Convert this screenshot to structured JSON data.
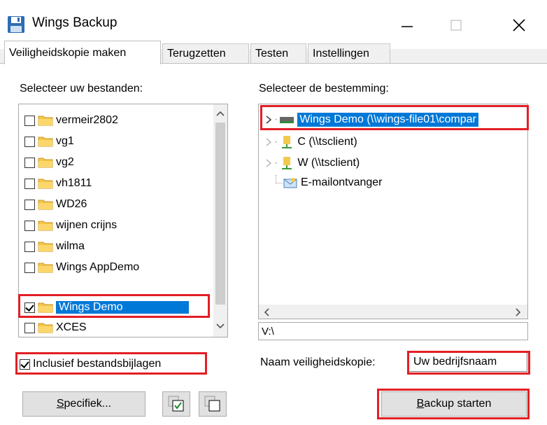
{
  "window": {
    "title": "Wings Backup",
    "controls": {
      "minimize": "—",
      "maximize": "☐",
      "close": "✕"
    }
  },
  "tabs": [
    {
      "label": "Veiligheidskopie maken",
      "active": true
    },
    {
      "label": "Terugzetten",
      "active": false
    },
    {
      "label": "Testen",
      "active": false
    },
    {
      "label": "Instellingen",
      "active": false
    }
  ],
  "source": {
    "label": "Selecteer uw bestanden:",
    "items": [
      {
        "label": "vermeir2802",
        "checked": false,
        "selected": false
      },
      {
        "label": "vg1",
        "checked": false,
        "selected": false
      },
      {
        "label": "vg2",
        "checked": false,
        "selected": false
      },
      {
        "label": "vh1811",
        "checked": false,
        "selected": false
      },
      {
        "label": "WD26",
        "checked": false,
        "selected": false
      },
      {
        "label": "wijnen crijns",
        "checked": false,
        "selected": false
      },
      {
        "label": "wilma",
        "checked": false,
        "selected": false
      },
      {
        "label": "Wings AppDemo",
        "checked": false,
        "selected": false
      },
      {
        "label": "Wings Demo",
        "checked": true,
        "selected": true
      },
      {
        "label": "XCES",
        "checked": false,
        "selected": false
      }
    ],
    "include_attachments": {
      "label": "Inclusief bestandsbijlagen",
      "checked": true
    },
    "specific_button": {
      "accel": "S",
      "rest": "pecifiek..."
    }
  },
  "destination": {
    "label": "Selecteer de bestemming:",
    "items": [
      {
        "label": "Wings Demo (\\\\wings-file01\\compar",
        "selected": true
      },
      {
        "label": "C (\\\\tsclient)",
        "selected": false
      },
      {
        "label": "W (\\\\tsclient)",
        "selected": false
      },
      {
        "label": "E-mailontvanger",
        "selected": false
      }
    ],
    "path": "V:\\",
    "backup_name_label": "Naam veiligheidskopie:",
    "backup_name_value": "Uw bedrijfsnaam",
    "start_button": {
      "accel": "B",
      "rest": "ackup starten"
    }
  },
  "colors": {
    "accent": "#0078d7",
    "highlight": "#e31e25"
  }
}
